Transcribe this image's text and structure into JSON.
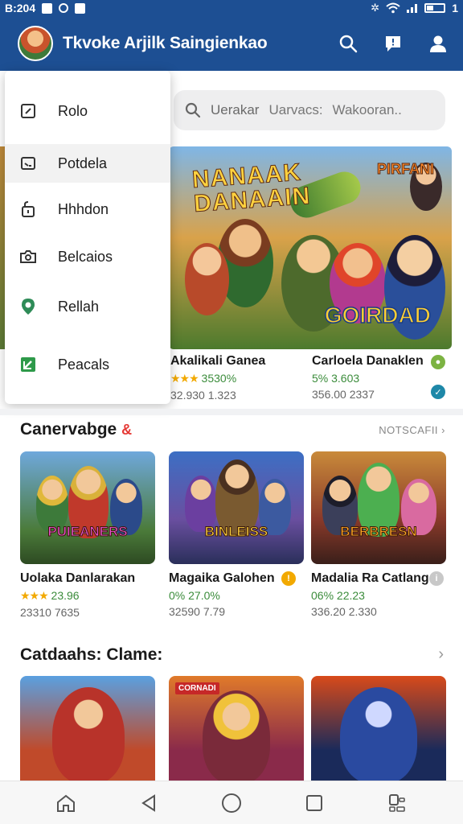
{
  "status_bar": {
    "time": "B:204",
    "right_text": "1"
  },
  "app_bar": {
    "title": "Tkvoke Arjilk Saingienkao",
    "icons": [
      "search-icon",
      "chat-icon",
      "profile-icon"
    ]
  },
  "search": {
    "placeholder": "Uerakar",
    "chips": [
      "Uarvacs:",
      "Wakooran.."
    ]
  },
  "drawer": {
    "items": [
      {
        "label": "Rolo",
        "icon": "edit-icon"
      },
      {
        "label": "Potdela",
        "icon": "image-icon"
      },
      {
        "label": "Hhhdon",
        "icon": "lock-icon"
      },
      {
        "label": "Belcaios",
        "icon": "camera-icon"
      },
      {
        "label": "Rellah",
        "icon": "location-icon"
      },
      {
        "label": "Peacals",
        "icon": "flag-icon"
      }
    ]
  },
  "featured": {
    "banner_texts": [
      "NANAAK",
      "DANAAIN",
      "PIRFANI",
      "GOIRDAD"
    ],
    "games": [
      {
        "title": "Akalikali Ganea",
        "rating": "3530%",
        "downloads": "32.930 1.323"
      },
      {
        "title": "Carloela Danaklen",
        "rating": "5% 3.603",
        "downloads": "356.00 2337"
      }
    ]
  },
  "section1": {
    "title": "Canervabge",
    "more": "NOTSCAFII",
    "cards": [
      {
        "logo": "PUIEANERS",
        "title": "Uolaka Danlarakan",
        "rating": "23.96",
        "downloads": "23310 7635"
      },
      {
        "logo": "BINLEISS",
        "title": "Magaika Galohen",
        "rating": "0% 27.0%",
        "downloads": "32590 7.79"
      },
      {
        "logo": "BERBRESN",
        "title": "Madalia Ra Catlang",
        "rating": "06% 22.23",
        "downloads": "336.20 2.330"
      }
    ]
  },
  "section2": {
    "title": "Catdaahs: Clame:",
    "banner_texts": [
      "CORNADI"
    ]
  },
  "colors": {
    "primary": "#1d4f93",
    "star": "#f2a900",
    "rating_green": "#3b8c3b"
  }
}
